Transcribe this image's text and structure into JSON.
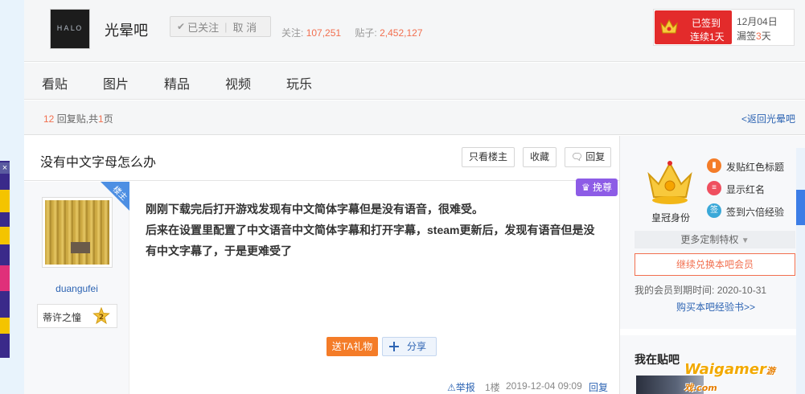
{
  "header": {
    "logo_text": "HALO",
    "forum_name": "光晕吧",
    "followed_label": "已关注",
    "cancel_label": "取 消",
    "follow_count_label": "关注:",
    "follow_count": "107,251",
    "post_count_label": "贴子:",
    "post_count": "2,452,127",
    "sign_status": "已签到",
    "sign_streak": "连续1天",
    "sign_date": "12月04日",
    "missed_label": "漏签",
    "missed_count": "3",
    "missed_unit": "天"
  },
  "nav": {
    "items": [
      "看贴",
      "图片",
      "精品",
      "视频",
      "玩乐"
    ]
  },
  "thread_info": {
    "reply_count": "12",
    "reply_label": "回复贴,共",
    "page_count": "1",
    "page_unit": "页",
    "back_link": "<返回光晕吧"
  },
  "post": {
    "title": "没有中文字母怎么办",
    "only_owner_label": "只看楼主",
    "favorite_label": "收藏",
    "reply_label": "回复",
    "owner_badge": "楼主",
    "author": "duangufei",
    "badge_name": "蒂许之憧",
    "badge_level": "2",
    "vip_tag": "挽尊",
    "content_line1": "刚刚下载完后打开游戏发现有中文简体字幕但是没有语音，很难受。",
    "content_line2": "后来在设置里配置了中文语音中文简体字幕和打开字幕，steam更新后，发现有语音但是没有中文字幕了，于是更难受了",
    "gift_label": "送TA礼物",
    "share_label": "分享",
    "report_label": "举报",
    "floor": "1楼",
    "time": "2019-12-04 09:09",
    "reply_link": "回复"
  },
  "sidebar": {
    "crown_label": "皇冠身份",
    "perks": [
      "发贴红色标题",
      "显示红名",
      "签到六倍经验"
    ],
    "perk_icon_3": "签",
    "more_perks": "更多定制特权",
    "renew_label": "继续兑换本吧会员",
    "expire_label": "我的会员到期时间:",
    "expire_date": "2020-10-31",
    "buy_link": "购买本吧经验书>>",
    "in_bar_title": "我在贴吧"
  },
  "watermark": {
    "main": "Waigamer",
    "sub": "游戏.com"
  },
  "colors": {
    "accent_red": "#e32b2b",
    "link_blue": "#2d64b3",
    "number_orange": "#f26f4f",
    "vip_purple": "#8d5ce6",
    "gift_orange": "#f47c28"
  }
}
